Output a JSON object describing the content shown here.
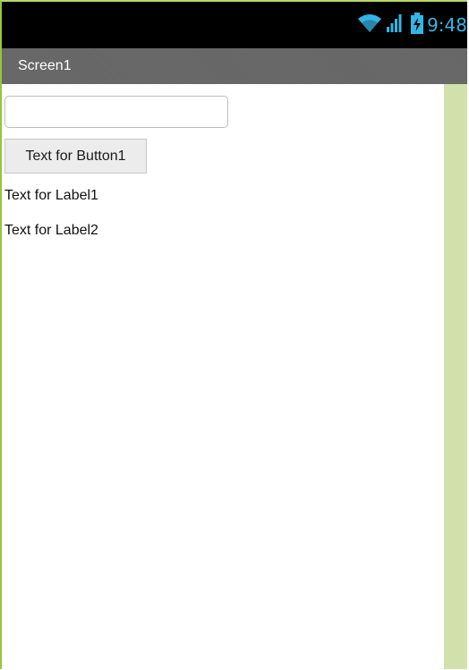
{
  "status_bar": {
    "time": "9:48",
    "icons": [
      "wifi-icon",
      "cell-signal-icon",
      "battery-charging-icon"
    ],
    "accent_color": "#33b5e5"
  },
  "title_bar": {
    "title": "Screen1"
  },
  "form": {
    "textbox": {
      "value": "",
      "placeholder": ""
    },
    "button1_label": "Text for Button1",
    "label1": "Text for Label1",
    "label2": "Text for Label2"
  },
  "colors": {
    "frame_border": "#9ac43c",
    "right_panel": "#d2e1ab",
    "title_bar": "#686868"
  }
}
